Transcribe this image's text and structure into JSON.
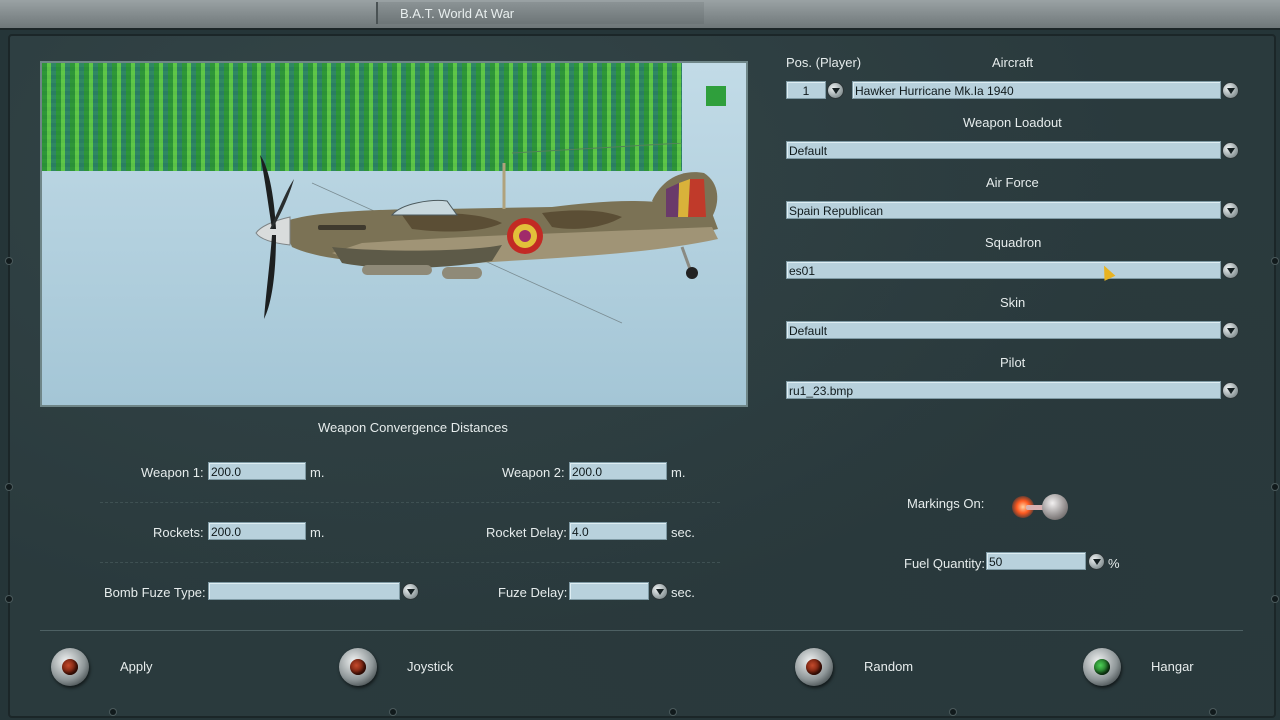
{
  "window": {
    "title": "B.A.T. World At War",
    "left_text": "",
    "right_text": ""
  },
  "right_panel": {
    "pos_label": "Pos. (Player)",
    "pos_value": "1",
    "aircraft_label": "Aircraft",
    "aircraft_value": "Hawker Hurricane Mk.Ia 1940",
    "weapon_loadout_label": "Weapon Loadout",
    "weapon_loadout_value": "Default",
    "air_force_label": "Air Force",
    "air_force_value": "Spain Republican",
    "squadron_label": "Squadron",
    "squadron_value": "es01",
    "skin_label": "Skin",
    "skin_value": "Default",
    "pilot_label": "Pilot",
    "pilot_value": "ru1_23.bmp",
    "markings_label": "Markings On:",
    "markings_on": true,
    "fuel_label": "Fuel Quantity:",
    "fuel_value": "50",
    "fuel_unit": "%"
  },
  "convergence": {
    "title": "Weapon Convergence Distances",
    "weapon1_label": "Weapon 1:",
    "weapon1_value": "200.0",
    "weapon1_unit": "m.",
    "weapon2_label": "Weapon 2:",
    "weapon2_value": "200.0",
    "weapon2_unit": "m.",
    "rockets_label": "Rockets:",
    "rockets_value": "200.0",
    "rockets_unit": "m.",
    "rocket_delay_label": "Rocket Delay:",
    "rocket_delay_value": "4.0",
    "rocket_delay_unit": "sec.",
    "bomb_fuze_label": "Bomb Fuze Type:",
    "bomb_fuze_value": "",
    "fuze_delay_label": "Fuze Delay:",
    "fuze_delay_value": "",
    "fuze_delay_unit": "sec."
  },
  "buttons": {
    "apply": "Apply",
    "joystick": "Joystick",
    "random": "Random",
    "hangar": "Hangar"
  },
  "colors": {
    "panel": "#2a3a3d",
    "field": "#b8d1dc",
    "lamp_red": "#c44a2c",
    "lamp_green": "#4cd056"
  },
  "icons": [
    "dropdown-arrow-icon",
    "knob-button-icon",
    "toggle-switch-icon",
    "mouse-cursor-icon",
    "aircraft-preview"
  ]
}
